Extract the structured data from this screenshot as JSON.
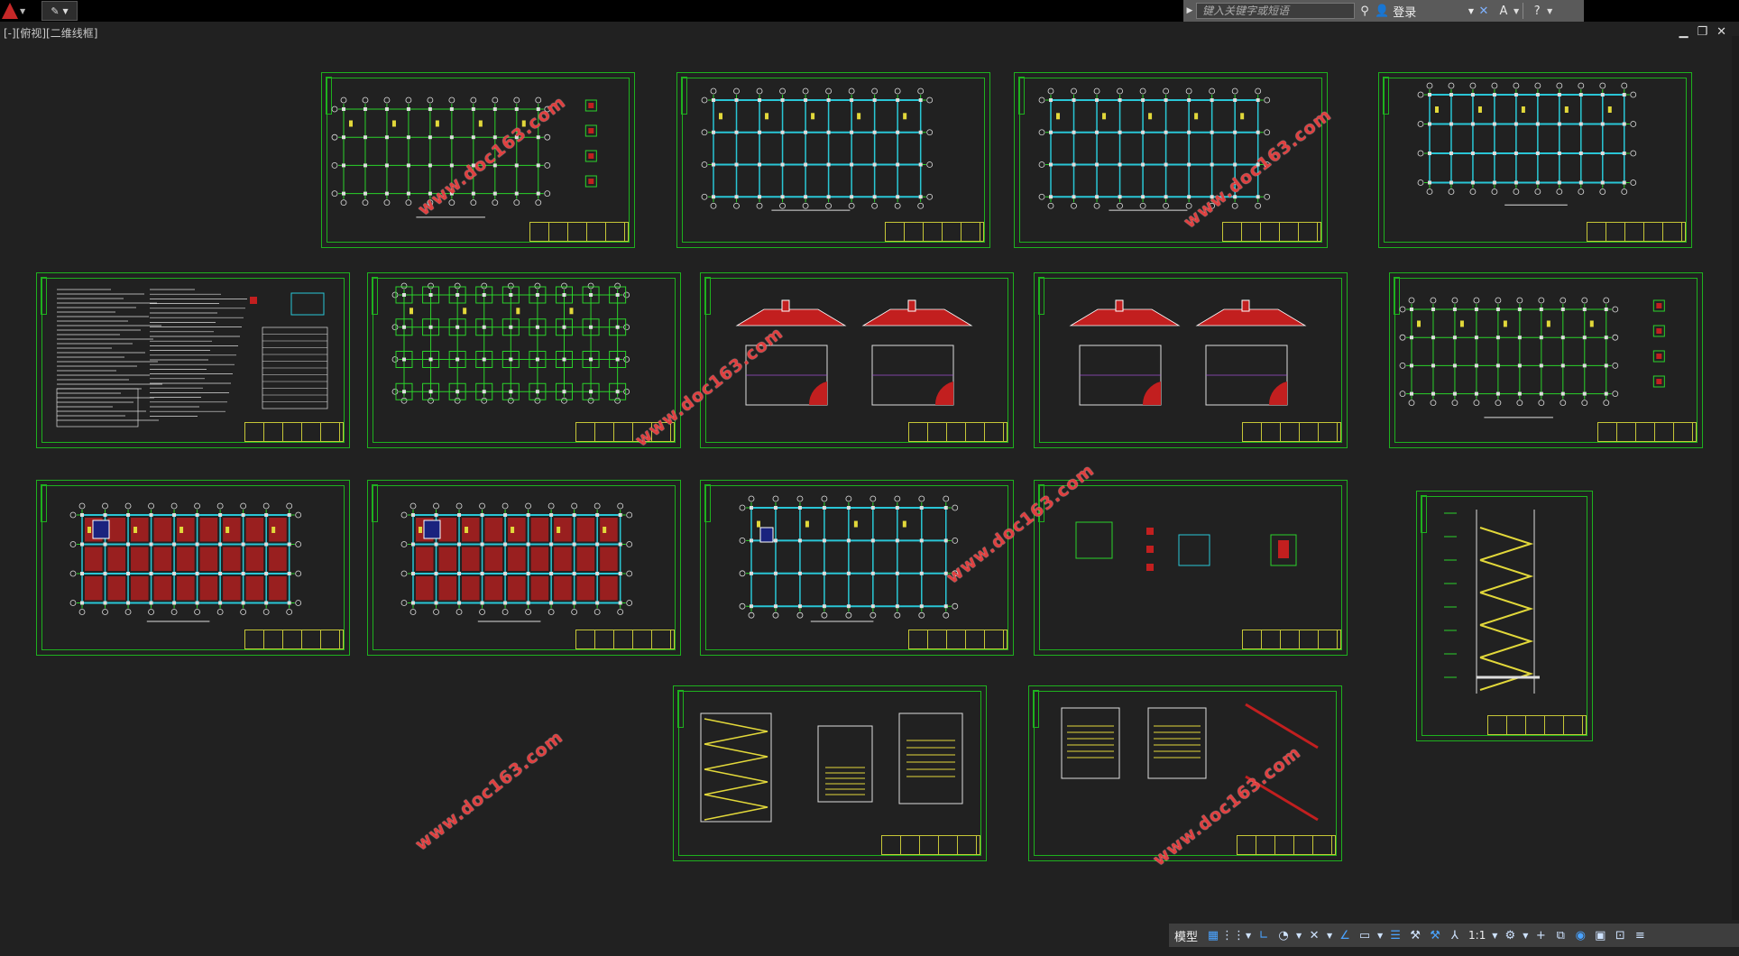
{
  "titlebar": {
    "search_placeholder": "键入关键字或短语",
    "login_label": "登录",
    "help_icon": "help-icon"
  },
  "viewport": {
    "label": "[-][俯视][二维线框]"
  },
  "watermark_text": "www.doc163.com",
  "statusbar": {
    "model_label": "模型",
    "scale_label": "1:1"
  },
  "colors": {
    "background": "#212121",
    "frame": "#1eb11e",
    "grid_green": "#2ad32a",
    "beam_cyan": "#29c6d6",
    "fill_red": "#c21f1f",
    "accent_yellow": "#e2d83a",
    "watermark": "#e04040"
  }
}
